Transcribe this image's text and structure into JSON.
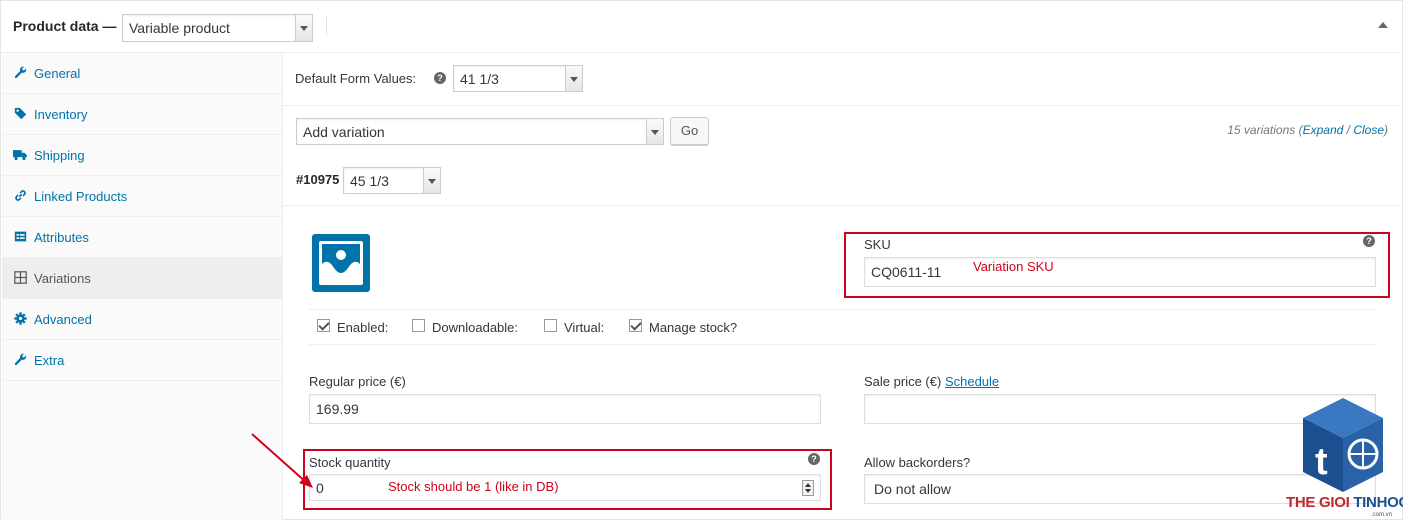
{
  "header": {
    "title": "Product data —",
    "product_type": "Variable product"
  },
  "sidebar": {
    "items": [
      {
        "label": "General",
        "icon": "wrench-icon"
      },
      {
        "label": "Inventory",
        "icon": "tag-icon"
      },
      {
        "label": "Shipping",
        "icon": "truck-icon"
      },
      {
        "label": "Linked Products",
        "icon": "link-icon"
      },
      {
        "label": "Attributes",
        "icon": "list-icon"
      },
      {
        "label": "Variations",
        "icon": "grid-icon",
        "active": true
      },
      {
        "label": "Advanced",
        "icon": "gear-icon"
      },
      {
        "label": "Extra",
        "icon": "wrench-icon"
      }
    ]
  },
  "defaults": {
    "label": "Default Form Values:",
    "value": "41 1/3"
  },
  "variation_actions": {
    "selected": "Add variation",
    "go_label": "Go",
    "count_text": "15 variations (",
    "expand": "Expand",
    "slash": " / ",
    "close": "Close",
    "close_paren": ")"
  },
  "variation": {
    "id": "#10975",
    "attribute_value": "45 1/3",
    "sku_label": "SKU",
    "sku_value": "CQ0611-11",
    "checkboxes": [
      {
        "label": "Enabled:",
        "checked": true
      },
      {
        "label": "Downloadable:",
        "checked": false
      },
      {
        "label": "Virtual:",
        "checked": false
      },
      {
        "label": "Manage stock?",
        "checked": true
      }
    ],
    "regular_price_label": "Regular price (€)",
    "regular_price_value": "169.99",
    "sale_price_label": "Sale price (€)",
    "schedule_link": "Schedule",
    "sale_price_value": "",
    "stock_label": "Stock quantity",
    "stock_value": "0",
    "backorders_label": "Allow backorders?",
    "backorders_value": "Do not allow"
  },
  "annotations": {
    "sku_note": "Variation SKU",
    "stock_note": "Stock should be 1 (like in DB)",
    "color": "#d0021b"
  },
  "watermark": {
    "brand_part1": "THE GIOI ",
    "brand_part2": "TINHOC",
    "domain": ".com.vn"
  },
  "colors": {
    "link": "#0073aa",
    "brand_red": "#c0272d",
    "brand_blue": "#1b4f8f"
  }
}
